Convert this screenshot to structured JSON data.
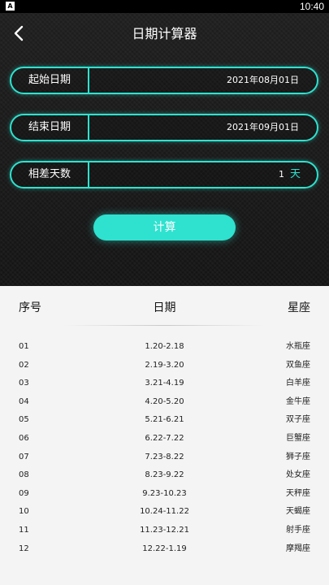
{
  "status_bar": {
    "badge": "A",
    "time": "10:40"
  },
  "header": {
    "title": "日期计算器"
  },
  "form": {
    "start": {
      "label": "起始日期",
      "value": "2021年08月01日"
    },
    "end": {
      "label": "结束日期",
      "value": "2021年09月01日"
    },
    "diff": {
      "label": "相差天数",
      "value": "1",
      "unit": "天"
    },
    "calc_label": "计算"
  },
  "table": {
    "headers": {
      "index": "序号",
      "date": "日期",
      "sign": "星座"
    },
    "rows": [
      {
        "index": "01",
        "date": "1.20-2.18",
        "sign": "水瓶座"
      },
      {
        "index": "02",
        "date": "2.19-3.20",
        "sign": "双鱼座"
      },
      {
        "index": "03",
        "date": "3.21-4.19",
        "sign": "白羊座"
      },
      {
        "index": "04",
        "date": "4.20-5.20",
        "sign": "金牛座"
      },
      {
        "index": "05",
        "date": "5.21-6.21",
        "sign": "双子座"
      },
      {
        "index": "06",
        "date": "6.22-7.22",
        "sign": "巨蟹座"
      },
      {
        "index": "07",
        "date": "7.23-8.22",
        "sign": "狮子座"
      },
      {
        "index": "08",
        "date": "8.23-9.22",
        "sign": "处女座"
      },
      {
        "index": "09",
        "date": "9.23-10.23",
        "sign": "天秤座"
      },
      {
        "index": "10",
        "date": "10.24-11.22",
        "sign": "天蝎座"
      },
      {
        "index": "11",
        "date": "11.23-12.21",
        "sign": "射手座"
      },
      {
        "index": "12",
        "date": "12.22-1.19",
        "sign": "摩羯座"
      }
    ]
  },
  "colors": {
    "accent": "#2ee2cf",
    "dark_bg": "#1a1a1a",
    "table_bg": "#f4f4f4"
  }
}
